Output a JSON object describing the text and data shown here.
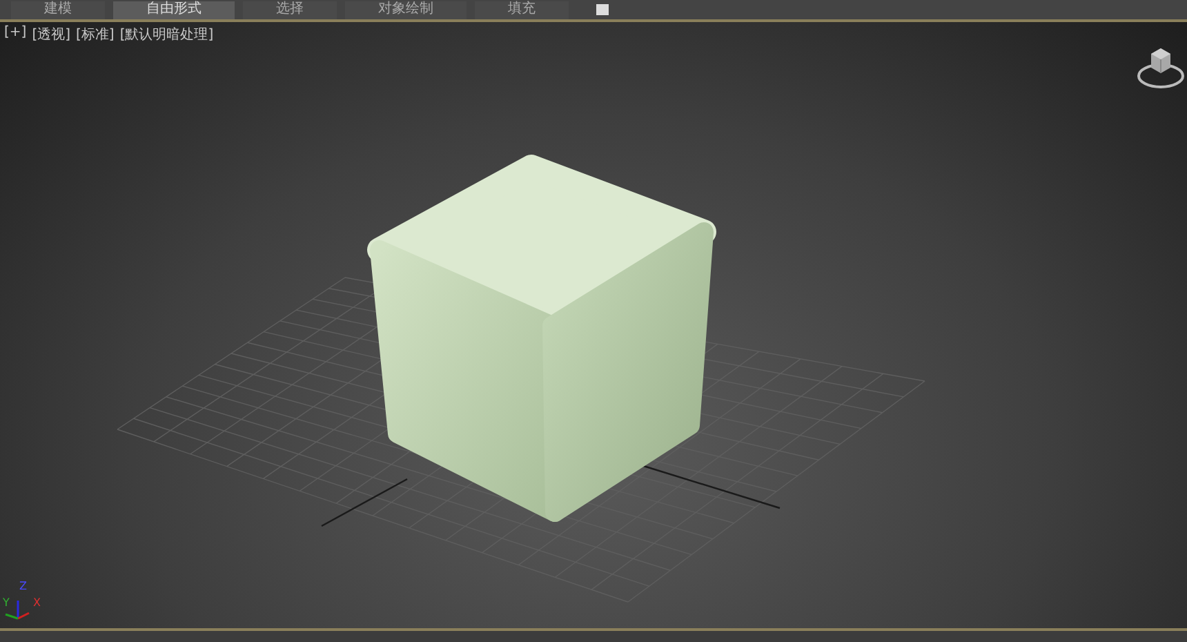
{
  "ribbon_tabs": [
    {
      "label": "建模",
      "selected": false
    },
    {
      "label": "自由形式",
      "selected": true
    },
    {
      "label": "选择",
      "selected": false
    },
    {
      "label": "对象绘制",
      "selected": false
    },
    {
      "label": "填充",
      "selected": false
    }
  ],
  "viewport": {
    "labels": [
      "[+]",
      "[透视]",
      "[标准]",
      "[默认明暗处理]"
    ],
    "axes": {
      "x": "X",
      "y": "Y",
      "z": "Z"
    }
  }
}
